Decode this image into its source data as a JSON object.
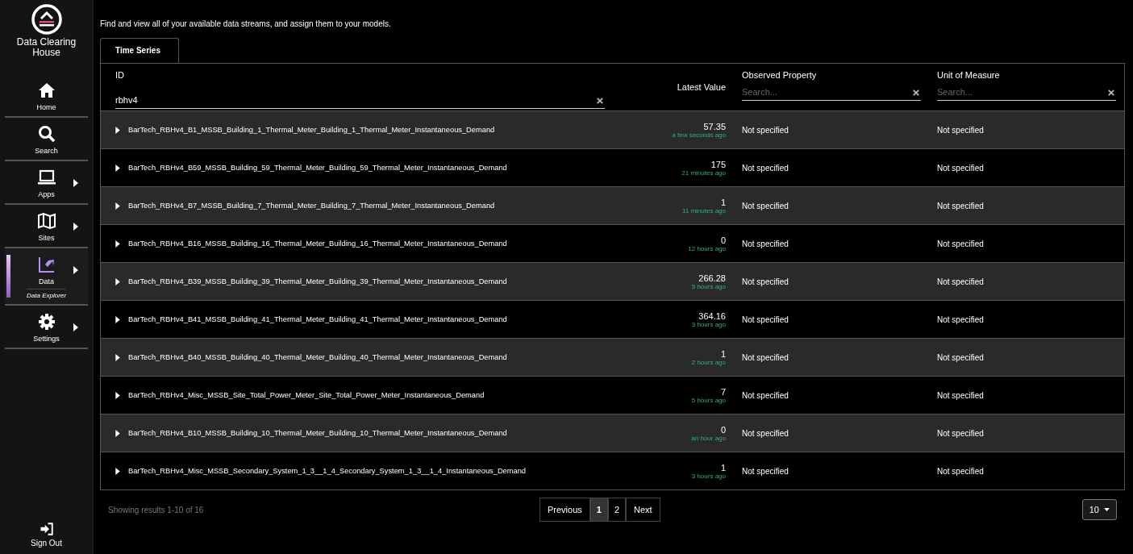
{
  "sidebar": {
    "logo_text": "Data Clearing House",
    "items": [
      {
        "kind": "home",
        "label": "Home",
        "selected": false,
        "has_submenu": false
      },
      {
        "kind": "search",
        "label": "Search",
        "selected": false,
        "has_submenu": false
      },
      {
        "kind": "apps",
        "label": "Apps",
        "selected": false,
        "has_submenu": true
      },
      {
        "kind": "sites",
        "label": "Sites",
        "selected": false,
        "has_submenu": true
      },
      {
        "kind": "data",
        "label": "Data",
        "selected": true,
        "has_submenu": true,
        "sub_label": "Data Explorer"
      },
      {
        "kind": "settings",
        "label": "Settings",
        "selected": false,
        "has_submenu": true
      }
    ],
    "sign_out": "Sign Out"
  },
  "description": "Find and view all of your available data streams, and assign them to your models.",
  "tabs": [
    {
      "label": "Time Series",
      "selected": true
    }
  ],
  "table": {
    "columns": [
      {
        "label": "ID",
        "filter": {
          "value": "rbhv4"
        }
      },
      {
        "label": "Latest Value"
      },
      {
        "label": "Observed Property",
        "filter": {
          "placeholder": "Search..."
        }
      },
      {
        "label": "Unit of Measure",
        "filter": {
          "placeholder": "Search..."
        }
      }
    ],
    "rows": [
      {
        "id": "BarTech_RBHv4_B1_MSSB_Building_1_Thermal_Meter_Building_1_Thermal_Meter_Instantaneous_Demand",
        "value": "57.35",
        "updated": "a few seconds ago",
        "property": "Not specified",
        "unit": "Not specified"
      },
      {
        "id": "BarTech_RBHv4_B59_MSSB_Building_59_Thermal_Meter_Building_59_Thermal_Meter_Instantaneous_Demand",
        "value": "175",
        "updated": "21 minutes ago",
        "property": "Not specified",
        "unit": "Not specified"
      },
      {
        "id": "BarTech_RBHv4_B7_MSSB_Building_7_Thermal_Meter_Building_7_Thermal_Meter_Instantaneous_Demand",
        "value": "1",
        "updated": "11 minutes ago",
        "property": "Not specified",
        "unit": "Not specified"
      },
      {
        "id": "BarTech_RBHv4_B16_MSSB_Building_16_Thermal_Meter_Building_16_Thermal_Meter_Instantaneous_Demand",
        "value": "0",
        "updated": "12 hours ago",
        "property": "Not specified",
        "unit": "Not specified"
      },
      {
        "id": "BarTech_RBHv4_B39_MSSB_Building_39_Thermal_Meter_Building_39_Thermal_Meter_Instantaneous_Demand",
        "value": "266.28",
        "updated": "5 hours ago",
        "property": "Not specified",
        "unit": "Not specified"
      },
      {
        "id": "BarTech_RBHv4_B41_MSSB_Building_41_Thermal_Meter_Building_41_Thermal_Meter_Instantaneous_Demand",
        "value": "364.16",
        "updated": "3 hours ago",
        "property": "Not specified",
        "unit": "Not specified"
      },
      {
        "id": "BarTech_RBHv4_B40_MSSB_Building_40_Thermal_Meter_Building_40_Thermal_Meter_Instantaneous_Demand",
        "value": "1",
        "updated": "2 hours ago",
        "property": "Not specified",
        "unit": "Not specified"
      },
      {
        "id": "BarTech_RBHv4_Misc_MSSB_Site_Total_Power_Meter_Site_Total_Power_Meter_Instantaneous_Demand",
        "value": "7",
        "updated": "5 hours ago",
        "property": "Not specified",
        "unit": "Not specified"
      },
      {
        "id": "BarTech_RBHv4_B10_MSSB_Building_10_Thermal_Meter_Building_10_Thermal_Meter_Instantaneous_Demand",
        "value": "0",
        "updated": "an hour ago",
        "property": "Not specified",
        "unit": "Not specified"
      },
      {
        "id": "BarTech_RBHv4_Misc_MSSB_Secondary_System_1_3__1_4_Secondary_System_1_3__1_4_Instantaneous_Demand",
        "value": "1",
        "updated": "3 hours ago",
        "property": "Not specified",
        "unit": "Not specified"
      }
    ]
  },
  "footer": {
    "summary": "Showing results 1-10 of 16",
    "pagination": [
      {
        "label": "Previous",
        "kind": "nav"
      },
      {
        "label": "1",
        "kind": "page",
        "selected": true
      },
      {
        "label": "2",
        "kind": "page",
        "selected": false
      },
      {
        "label": "Next",
        "kind": "nav"
      }
    ],
    "page_size": "10"
  }
}
